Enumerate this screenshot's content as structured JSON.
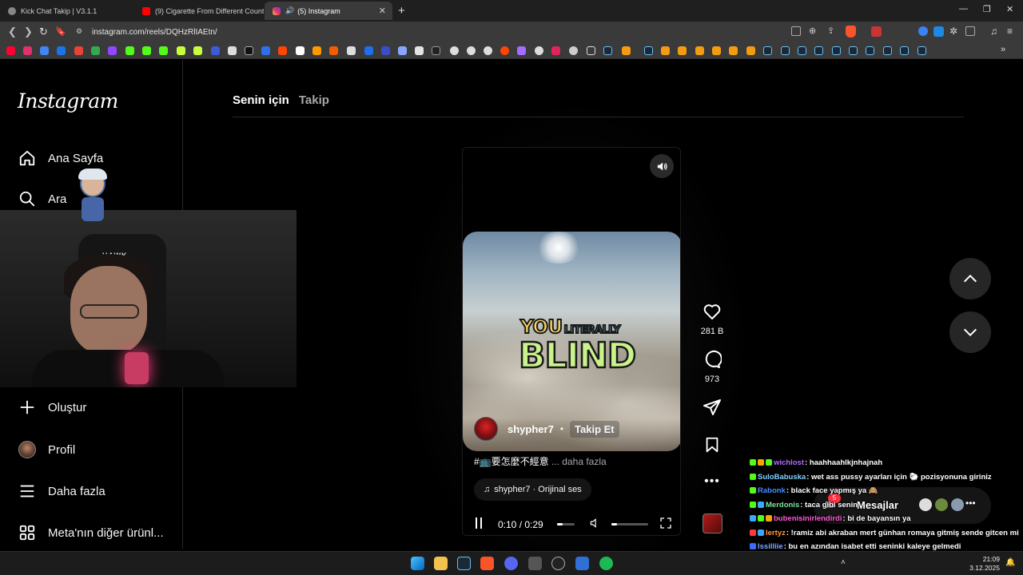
{
  "browser": {
    "tabs": [
      {
        "title": "Kick Chat Takip | V3.1.1",
        "active": false
      },
      {
        "title": "(9) Cigarette From Different Countrie",
        "active": false
      },
      {
        "title": "(5) Instagram",
        "active": true
      }
    ],
    "url": "instagram.com/reels/DQHzRlIAEtn/",
    "new_tab_label": "+"
  },
  "sidebar": {
    "logo": "Instagram",
    "items": [
      {
        "label": "Ana Sayfa",
        "icon": "home-icon"
      },
      {
        "label": "Ara",
        "icon": "search-icon"
      },
      {
        "label": "Oluştur",
        "icon": "plus-icon"
      },
      {
        "label": "Profil",
        "icon": "profile-avatar"
      },
      {
        "label": "Daha fazla",
        "icon": "menu-icon"
      },
      {
        "label": "Meta'nın diğer ürünl...",
        "icon": "grid-icon"
      }
    ]
  },
  "feed_tabs": {
    "for_you": "Senin için",
    "following": "Takip"
  },
  "reel": {
    "caption_top": "YOU",
    "caption_small": "LITERALLY",
    "caption_big": "BLIND",
    "author": "shypher7",
    "separator": "•",
    "follow_label": "Takip Et",
    "caption_text": "#📺要怎麼不經意",
    "caption_more": "... daha fazla",
    "audio_label": "shypher7 · Orijinal ses",
    "time": "0:10 / 0:29",
    "progress": 0.34,
    "volume": 0.15
  },
  "actions": {
    "likes": "281 B",
    "comments": "973"
  },
  "messages": {
    "label": "Mesajlar",
    "badge": "5"
  },
  "chat": [
    {
      "user": "wichlost",
      "color": "#b06cff",
      "text": ": haahhaahlkjnhajnah",
      "badges": [
        "#53fc18",
        "#f7a600",
        "#53fc18"
      ]
    },
    {
      "user": "SuloBabuska",
      "color": "#7fd1ff",
      "text": ": wet ass pussy ayarları için 🐑 pozisyonuna giriniz",
      "badges": [
        "#53fc18"
      ]
    },
    {
      "user": "Rabonk",
      "color": "#4a8cff",
      "text": ": black face yapmış ya 🙈",
      "badges": [
        "#53fc18"
      ]
    },
    {
      "user": "Merdonis",
      "color": "#7fe3a0",
      "text": ": taca gibi senin",
      "badges": [
        "#53fc18",
        "#3ba7ff"
      ]
    },
    {
      "user": "bubenisinirlendirdi",
      "color": "#ff5ad6",
      "text": ": bi de bayansın ya",
      "badges": [
        "#3ba7ff",
        "#53fc18",
        "#f7a600"
      ]
    },
    {
      "user": "lertyz",
      "color": "#ff9a3c",
      "text": ": !ramiz abi akraban mert günhan romaya gitmiş sende gitcen mi",
      "badges": [
        "#ff3b3b",
        "#3ba7ff"
      ]
    },
    {
      "user": "lssilliie",
      "color": "#7aa6ff",
      "text": ": bu en azından isabet etti seninki kaleye gelmedi",
      "badges": [
        "#3b6bff"
      ]
    }
  ],
  "webcam": {
    "chair_brand": "HAWK"
  },
  "taskbar": {
    "time": "21:09",
    "date": "3.12.2025"
  },
  "colors": {
    "accent_blue": "#0095f6",
    "like_red": "#ff3040",
    "background": "#000000"
  }
}
